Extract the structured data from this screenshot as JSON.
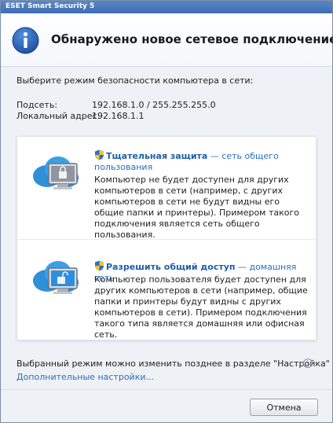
{
  "window": {
    "title": "ESET Smart Security 5"
  },
  "header": {
    "title": "Обнаружено новое сетевое подключение",
    "icon": "info-icon"
  },
  "prompt": "Выберите режим безопасности компьютера в сети:",
  "network": {
    "subnet_label": "Подсеть:",
    "subnet_value": "192.168.1.0 / 255.255.255.0",
    "local_label": "Локальный адрес:",
    "local_value": "192.168.1.1"
  },
  "options": [
    {
      "icon": "locked-computer-icon",
      "title": "Тщательная защита",
      "subtitle": " — сеть общего пользования",
      "description": "Компьютер не будет доступен для других компьютеров в сети (например, с других компьютеров в сети не будут видны его общие папки и принтеры). Примером такого подключения является сеть общего пользования."
    },
    {
      "icon": "shared-computer-icon",
      "title": "Разрешить общий доступ",
      "subtitle": " — домашняя сеть",
      "description": "Компьютер пользователя будет доступен для других компьютеров в сети (например, общие папки и принтеры будут видны с других компьютеров в сети). Примером подключения такого типа является домашняя или офисная сеть."
    }
  ],
  "footer": {
    "note": "Выбранный режим можно изменить позднее в разделе \"Настройка\"",
    "hint_glyph": "i",
    "advanced_link": "Дополнительные настройки...",
    "cancel_label": "Отмена"
  },
  "colors": {
    "accent": "#1e5fa8",
    "link": "#2a6ebf",
    "title_bar": "#3e6db3"
  }
}
